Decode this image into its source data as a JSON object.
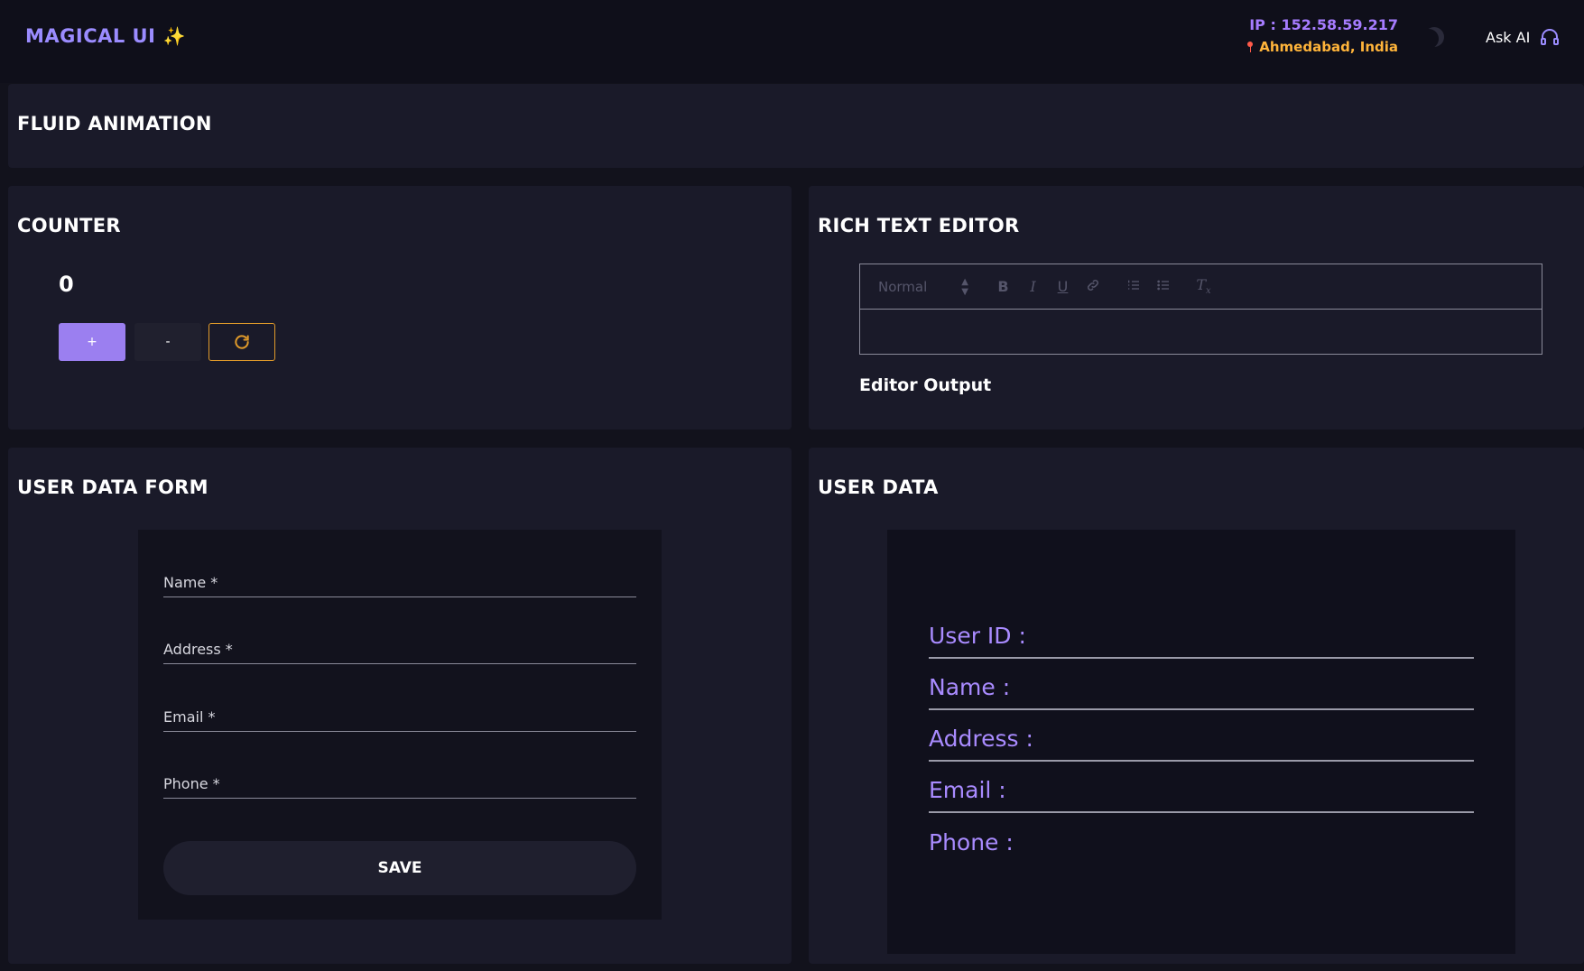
{
  "header": {
    "logo_text": "MAGICAL UI",
    "logo_icon": "✨",
    "ip_text": "IP : 152.58.59.217",
    "location_text": "Ahmedabad, India",
    "ask_ai_label": "Ask AI"
  },
  "fluid": {
    "title": "FLUID ANIMATION"
  },
  "counter": {
    "title": "COUNTER",
    "value": "0",
    "plus_label": "+",
    "minus_label": "-"
  },
  "editor": {
    "title": "RICH TEXT EDITOR",
    "format_select": "Normal",
    "output_label": "Editor Output",
    "toolbar_icons": [
      "bold-icon",
      "italic-icon",
      "underline-icon",
      "link-icon",
      "ordered-list-icon",
      "bullet-list-icon",
      "clear-format-icon"
    ]
  },
  "form": {
    "title": "USER DATA FORM",
    "fields": [
      {
        "label": "Name *",
        "value": ""
      },
      {
        "label": "Address *",
        "value": ""
      },
      {
        "label": "Email *",
        "value": ""
      },
      {
        "label": "Phone *",
        "value": ""
      }
    ],
    "save_label": "SAVE"
  },
  "user_data": {
    "title": "USER DATA",
    "rows": [
      {
        "label": "User ID :"
      },
      {
        "label": "Name :"
      },
      {
        "label": "Address :"
      },
      {
        "label": "Email :"
      },
      {
        "label": "Phone :"
      }
    ]
  },
  "colors": {
    "accent": "#9b7ff0",
    "orange": "#ffb43a",
    "background": "#12121c",
    "card": "#1a1a29"
  }
}
